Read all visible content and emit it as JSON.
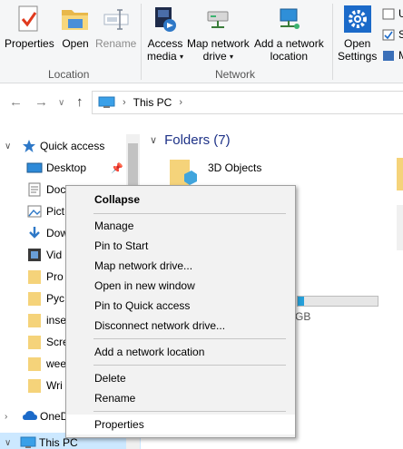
{
  "ribbon": {
    "open_group": {
      "label": "Location",
      "properties": "Properties",
      "open": "Open",
      "rename": "Rename"
    },
    "network_group": {
      "label": "Network",
      "access_media_line1": "Access",
      "access_media_line2": "media",
      "map_drive_line1": "Map network",
      "map_drive_line2": "drive",
      "add_location_line1": "Add a network",
      "add_location_line2": "location",
      "dropdown_glyph": "▾"
    },
    "system_group": {
      "open_settings_line1": "Open",
      "open_settings_line2": "Settings",
      "mini1": "U",
      "mini2": "S",
      "mini3": "M"
    }
  },
  "address": {
    "path": "This PC",
    "chevron": "›"
  },
  "nav_pane": {
    "quick_access": "Quick access",
    "items": [
      {
        "label": "Desktop",
        "pinned": true
      },
      {
        "label": "Doc"
      },
      {
        "label": "Pict"
      },
      {
        "label": "Dow"
      },
      {
        "label": "Vid"
      },
      {
        "label": "Pro"
      },
      {
        "label": "Pyc"
      },
      {
        "label": "inse"
      },
      {
        "label": "Scre"
      },
      {
        "label": "wee"
      },
      {
        "label": "Wri"
      }
    ],
    "onedrive": "OneD",
    "this_pc": "This PC"
  },
  "content": {
    "folders_header": "Folders (7)",
    "folder_first": "3D Objects",
    "drive_size_suffix": "GB"
  },
  "context_menu": {
    "items": [
      "Collapse",
      "Manage",
      "Pin to Start",
      "Map network drive...",
      "Open in new window",
      "Pin to Quick access",
      "Disconnect network drive...",
      "Add a network location",
      "Delete",
      "Rename",
      "Properties"
    ]
  },
  "colors": {
    "accent": "#1e3287",
    "selection": "#cce8ff",
    "folder": "#f5d37a"
  }
}
